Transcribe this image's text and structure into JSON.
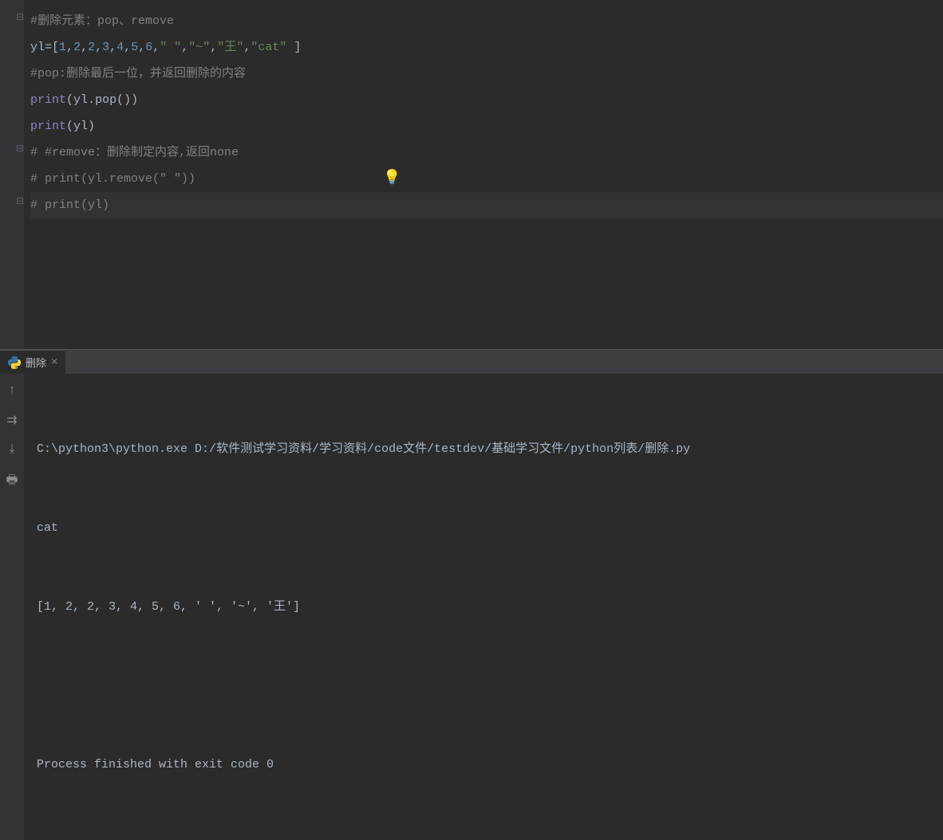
{
  "code": {
    "line1": {
      "comment": "#删除元素：pop、remove"
    },
    "line2": {
      "varname": "yl",
      "eq": "=[",
      "n1": "1",
      "n2": "2",
      "n3": "2",
      "n4": "3",
      "n5": "4",
      "n6": "5",
      "n7": "6",
      "s1": "\" \"",
      "s2": "\"~\"",
      "s3": "\"王\"",
      "s4": "\"cat\"",
      "space": " ",
      "close": "]"
    },
    "line3": {
      "comment": "#pop:删除最后一位，并返回删除的内容"
    },
    "line4": {
      "print": "print",
      "open": "(",
      "var": "yl",
      "dot": ".",
      "method": "pop",
      "paren": "())"
    },
    "line5": {
      "print": "print",
      "open": "(",
      "var": "yl",
      "close": ")"
    },
    "line6": {
      "comment": "# #remove：删除制定内容,返回none"
    },
    "line7": {
      "comment": "# print(yl.remove(\" \"))"
    },
    "line8": {
      "comment": "# print(yl)"
    }
  },
  "tab": {
    "title": "删除",
    "close": "×"
  },
  "output": {
    "cmd_prefix": "C:\\python3\\python.exe ",
    "cmd_path_d": "D:/",
    "cmd_path_cn1": "软件测试学习资料",
    "slash": "/",
    "cmd_path_cn2": "学习资料",
    "cmd_path_code": "/code",
    "cmd_path_cn3": "文件",
    "cmd_path_test": "/testdev/",
    "cmd_path_cn4": "基础学习文件",
    "cmd_path_py": "/python",
    "cmd_path_cn5": "列表",
    "cmd_path_cn6": "删除",
    "cmd_ext": ".py",
    "line2": "cat",
    "line3": "[1, 2, 2, 3, 4, 5, 6, ' ', '~', '王']",
    "line4": "",
    "line5": "Process finished with exit code 0"
  },
  "icons": {
    "bulb": "💡",
    "up_arrow": "↑",
    "steps": "⇉",
    "download": "⤓",
    "print": "🖶"
  }
}
